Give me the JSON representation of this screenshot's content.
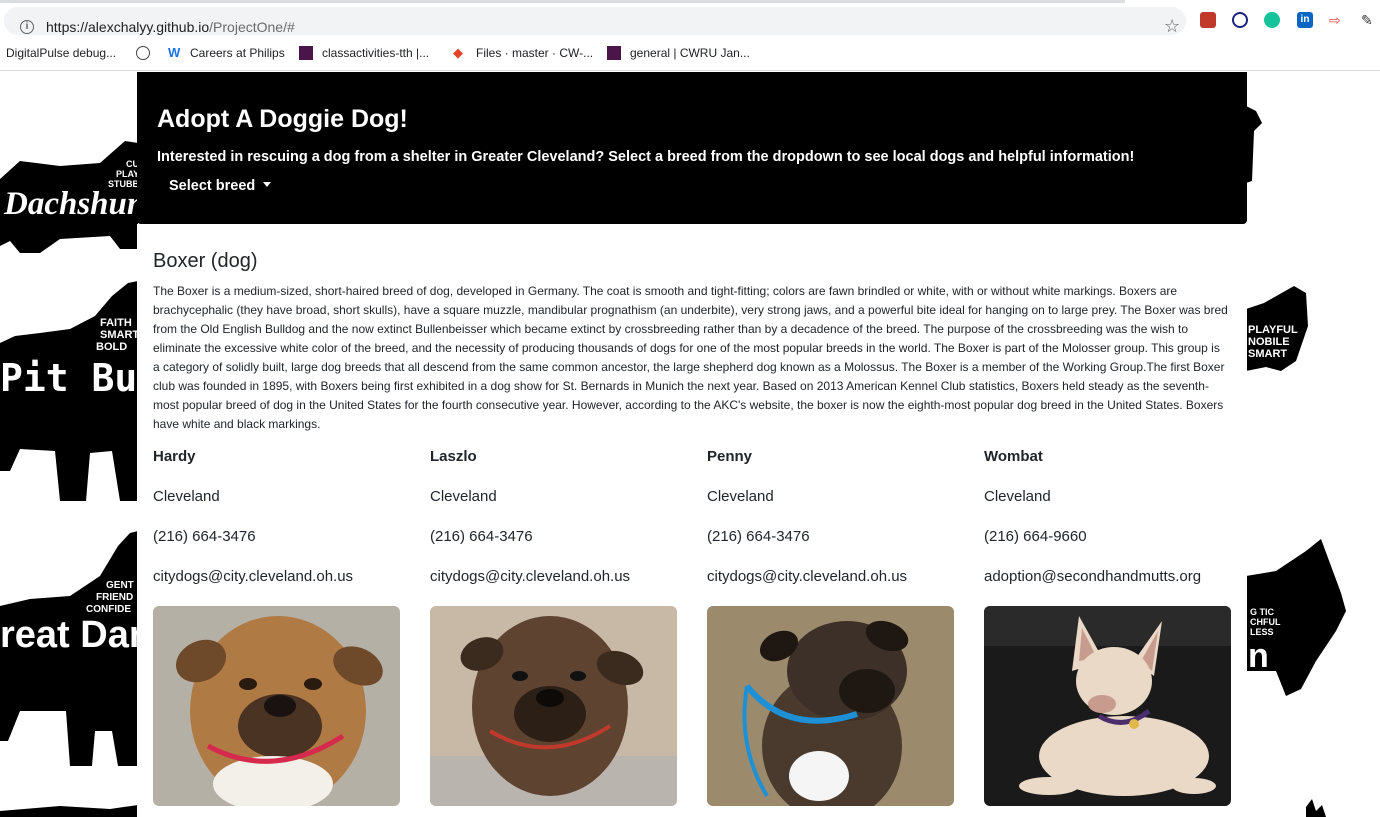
{
  "browser": {
    "url_host": "https://alexchalyy.github.io",
    "url_path": "/ProjectOne/#",
    "bookmarks": [
      "DigitalPulse debug...",
      "Careers at Philips",
      "classactivities-tth |...",
      "Files · master · CW-...",
      "general | CWRU Jan..."
    ]
  },
  "hero": {
    "title": "Adopt A Doggie Dog!",
    "subtitle": "Interested in rescuing a dog from a shelter in Greater Cleveland? Select a breed from the dropdown to see local dogs and helpful information!",
    "dropdown_label": "Select breed"
  },
  "background_words": {
    "left": [
      "Dachshun",
      "Pit Bull",
      "reat Dane"
    ],
    "left_traits": [
      [
        "CU",
        "PLAY",
        "STUBBO"
      ],
      [
        "FAITH",
        "SMART",
        "BOLD"
      ],
      [
        "GENT",
        "FRIEND",
        "CONFIDE"
      ]
    ],
    "right_traits": [
      [
        "PLAYFUL",
        "NOBILE",
        "SMART"
      ],
      [
        "G TIC",
        "CHFUL",
        "LESS"
      ]
    ],
    "right_word": "n"
  },
  "breed": {
    "title": "Boxer (dog)",
    "description": "The Boxer is a medium-sized, short-haired breed of dog, developed in Germany. The coat is smooth and tight-fitting; colors are fawn brindled or white, with or without white markings. Boxers are brachycephalic (they have broad, short skulls), have a square muzzle, mandibular prognathism (an underbite), very strong jaws, and a powerful bite ideal for hanging on to large prey. The Boxer was bred from the Old English Bulldog and the now extinct Bullenbeisser which became extinct by crossbreeding rather than by a decadence of the breed. The purpose of the crossbreeding was the wish to eliminate the excessive white color of the breed, and the necessity of producing thousands of dogs for one of the most popular breeds in the world. The Boxer is part of the Molosser group. This group is a category of solidly built, large dog breeds that all descend from the same common ancestor, the large shepherd dog known as a Molossus. The Boxer is a member of the Working Group.The first Boxer club was founded in 1895, with Boxers being first exhibited in a dog show for St. Bernards in Munich the next year. Based on 2013 American Kennel Club statistics, Boxers held steady as the seventh-most popular breed of dog in the United States for the fourth consecutive year. However, according to the AKC's website, the boxer is now the eighth-most popular dog breed in the United States. Boxers have white and black markings."
  },
  "dogs": [
    {
      "name": "Hardy",
      "city": "Cleveland",
      "phone": "(216) 664-3476",
      "email": "citydogs@city.cleveland.oh.us",
      "bg": "#b5b0a6",
      "fur": "#b07a45",
      "dark": "#4a3322"
    },
    {
      "name": "Laszlo",
      "city": "Cleveland",
      "phone": "(216) 664-3476",
      "email": "citydogs@city.cleveland.oh.us",
      "bg": "#c8b8a6",
      "fur": "#5e4330",
      "dark": "#2c1f16"
    },
    {
      "name": "Penny",
      "city": "Cleveland",
      "phone": "(216) 664-3476",
      "email": "citydogs@city.cleveland.oh.us",
      "bg": "#9c8a6c",
      "fur": "#4a3a2e",
      "dark": "#1e1712"
    },
    {
      "name": "Wombat",
      "city": "Cleveland",
      "phone": "(216) 664-9660",
      "email": "adoption@secondhandmutts.org",
      "bg": "#1a1a1a",
      "fur": "#ead9c6",
      "dark": "#c79c8e"
    }
  ]
}
